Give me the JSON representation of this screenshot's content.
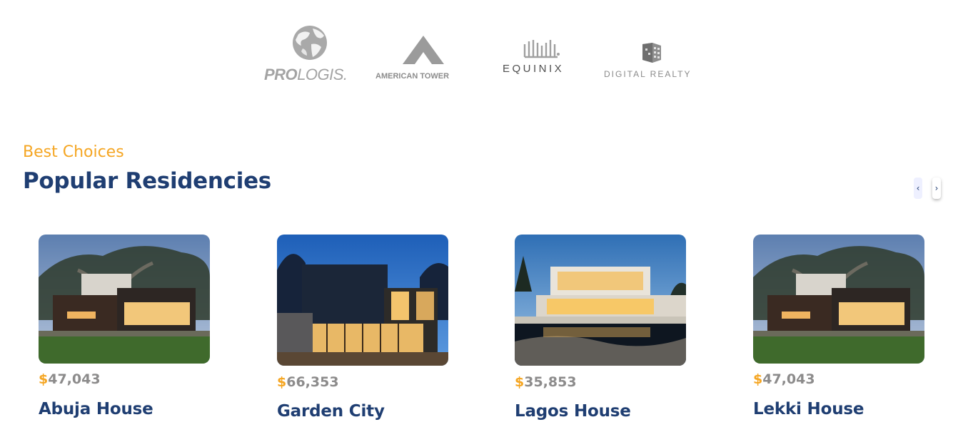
{
  "companies": [
    {
      "name": "PROLOGIS.",
      "bold": "PRO",
      "light": "LOGIS.",
      "icon": "globe-icon"
    },
    {
      "name": "AMERICAN TOWER",
      "icon": "tower-icon"
    },
    {
      "name": "EQUINIX",
      "icon": "equinix-bars-icon"
    },
    {
      "name": "DIGITAL REALTY",
      "icon": "cube-icon"
    }
  ],
  "residencies": {
    "eyebrow": "Best Choices",
    "title": "Popular Residencies",
    "nav": {
      "prev": "‹",
      "next": "›",
      "prev_icon": "chevron-left-icon",
      "next_icon": "chevron-right-icon"
    },
    "cards": [
      {
        "currency": "$",
        "price": "47,043",
        "name": "Abuja House"
      },
      {
        "currency": "$",
        "price": "66,353",
        "name": "Garden City"
      },
      {
        "currency": "$",
        "price": "35,853",
        "name": "Lagos House"
      },
      {
        "currency": "$",
        "price": "47,043",
        "name": "Lekki House"
      }
    ]
  },
  "colors": {
    "accent": "#f5a623",
    "title": "#1f3e72",
    "price": "#8c8b8b",
    "logo_gray": "#9a9a9a"
  }
}
